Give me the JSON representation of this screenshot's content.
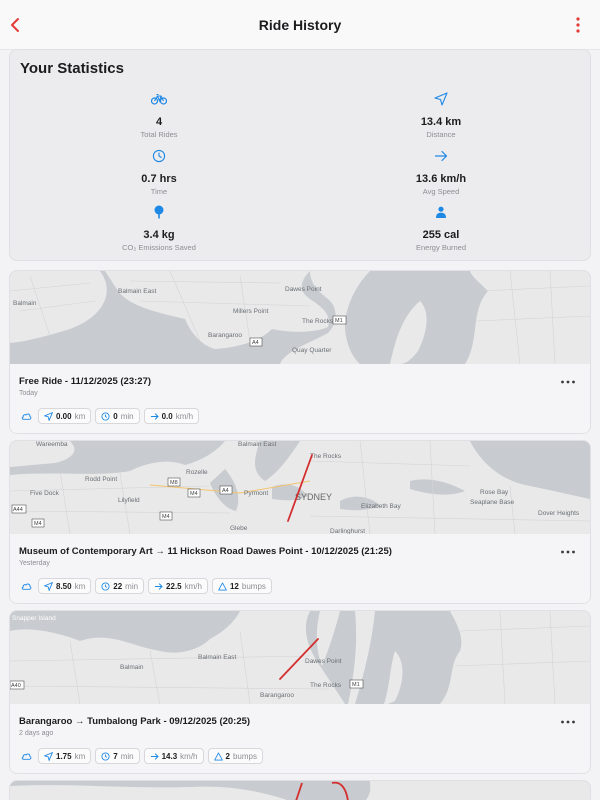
{
  "header": {
    "title": "Ride History"
  },
  "stats": {
    "heading": "Your Statistics",
    "items": [
      {
        "icon": "bicycle-icon",
        "value": "4",
        "label": "Total Rides"
      },
      {
        "icon": "navigation-arrow-icon",
        "value": "13.4 km",
        "label": "Distance"
      },
      {
        "icon": "clock-icon",
        "value": "0.7 hrs",
        "label": "Time"
      },
      {
        "icon": "arrow-right-icon",
        "value": "13.6 km/h",
        "label": "Avg Speed"
      },
      {
        "icon": "tree-icon",
        "value": "3.4 kg",
        "label": "CO₂ Emissions Saved"
      },
      {
        "icon": "person-icon",
        "value": "255 cal",
        "label": "Energy Burned"
      }
    ]
  },
  "rides": [
    {
      "title": "Free Ride - 11/12/2025 (23:27)",
      "when": "Today",
      "distance": "0.00",
      "distance_unit": "km",
      "duration": "0",
      "duration_unit": "min",
      "speed": "0.0",
      "speed_unit": "km/h",
      "bumps": null,
      "bumps_unit": null,
      "map_labels": [
        "Balmain East",
        "Dawes Point",
        "Balmain",
        "Millers Point",
        "The Rocks",
        "M1",
        "Barangaroo",
        "A4",
        "Quay Quarter"
      ]
    },
    {
      "title": "Museum of Contemporary Art → 11 Hickson Road Dawes Point - 10/12/2025 (21:25)",
      "when": "Yesterday",
      "distance": "8.50",
      "distance_unit": "km",
      "duration": "22",
      "duration_unit": "min",
      "speed": "22.5",
      "speed_unit": "km/h",
      "bumps": "12",
      "bumps_unit": "bumps",
      "map_labels": [
        "Wareemba",
        "Balmain East",
        "The Rocks",
        "Rodd Point",
        "Rozelle",
        "M8",
        "Five Dock",
        "Lilyfield",
        "M4",
        "A4",
        "Pyrmont",
        "SYDNEY",
        "Elizabeth Bay",
        "Rose Bay",
        "Seaplane Base",
        "A44",
        "M4",
        "Glebe",
        "Darlinghurst",
        "Dover Heights",
        "M4"
      ]
    },
    {
      "title": "Barangaroo → Tumbalong Park - 09/12/2025 (20:25)",
      "when": "2 days ago",
      "distance": "1.75",
      "distance_unit": "km",
      "duration": "7",
      "duration_unit": "min",
      "speed": "14.3",
      "speed_unit": "km/h",
      "bumps": "2",
      "bumps_unit": "bumps",
      "map_labels": [
        "Snapper Island",
        "Balmain East",
        "Dawes Point",
        "Balmain",
        "A40",
        "The Rocks",
        "M1",
        "Barangaroo"
      ]
    }
  ],
  "colors": {
    "accent": "#1e88e5",
    "back": "#e53935",
    "route": "#d32f2f",
    "water": "#c8cbcf",
    "land": "#e9e9ea"
  }
}
